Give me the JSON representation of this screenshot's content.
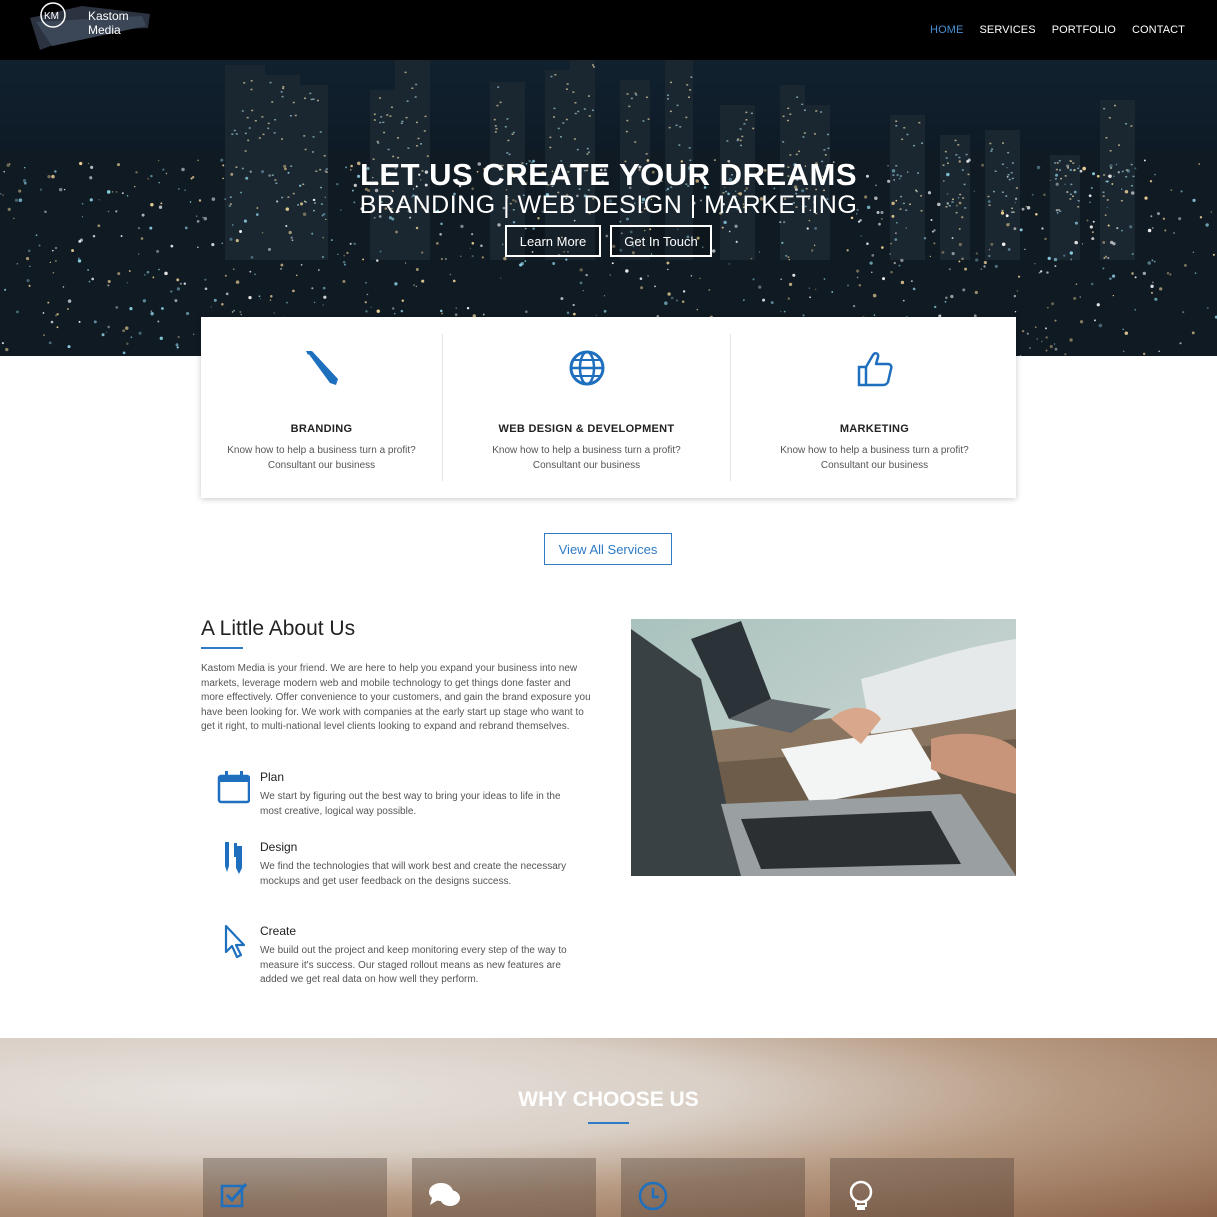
{
  "header": {
    "logo_text": "Kastom Media",
    "logo_mark": "KM",
    "nav": [
      "HOME",
      "SERVICES",
      "PORTFOLIO",
      "CONTACT"
    ]
  },
  "hero": {
    "title": "LET US CREATE YOUR DREAMS",
    "subtitle": "BRANDING | WEB DESIGN | MARKETING",
    "btn_learn": "Learn More",
    "btn_contact": "Get In Touch"
  },
  "services": [
    {
      "icon": "pencil-icon",
      "title": "BRANDING",
      "desc1": "Know how to help a business turn a profit?",
      "desc2": "Consultant our business"
    },
    {
      "icon": "globe-icon",
      "title": "WEB DESIGN & DEVELOPMENT",
      "desc1": "Know how to help a business turn a profit?",
      "desc2": "Consultant our business"
    },
    {
      "icon": "thumbs-up-icon",
      "title": "MARKETING",
      "desc1": "Know how to help a business turn a profit?",
      "desc2": "Consultant our business"
    }
  ],
  "view_all": "View All Services",
  "about": {
    "title": "A Little About Us",
    "text": "Kastom Media is your friend. We are here to help you expand your business into new markets, leverage modern web and mobile technology to get things done faster and more effectively. Offer convenience to your customers, and gain the brand exposure you have been looking for. We work with companies at the early start up stage who want to get it right, to multi-national level clients looking to expand and rebrand themselves.",
    "features": [
      {
        "icon": "calendar-icon",
        "title": "Plan",
        "desc": "We start by figuring out the best way to bring your ideas to life in the most creative, logical way possible."
      },
      {
        "icon": "pens-icon",
        "title": "Design",
        "desc": "We find the technologies that will work best and create the necessary mockups and get user feedback on the designs success."
      },
      {
        "icon": "cursor-icon",
        "title": "Create",
        "desc": "We build out the project and keep monitoring every step of the way to measure it's success. Our staged rollout means as new features are added we get real data on how well they perform."
      }
    ]
  },
  "why": {
    "title": "WHY CHOOSE US",
    "boxes": [
      "checkbox-icon",
      "chat-icon",
      "clock-icon",
      "lightbulb-icon"
    ]
  },
  "colors": {
    "accent": "#2f7ac4",
    "nav_active": "#4b8fd4",
    "header_bg": "#000000"
  }
}
